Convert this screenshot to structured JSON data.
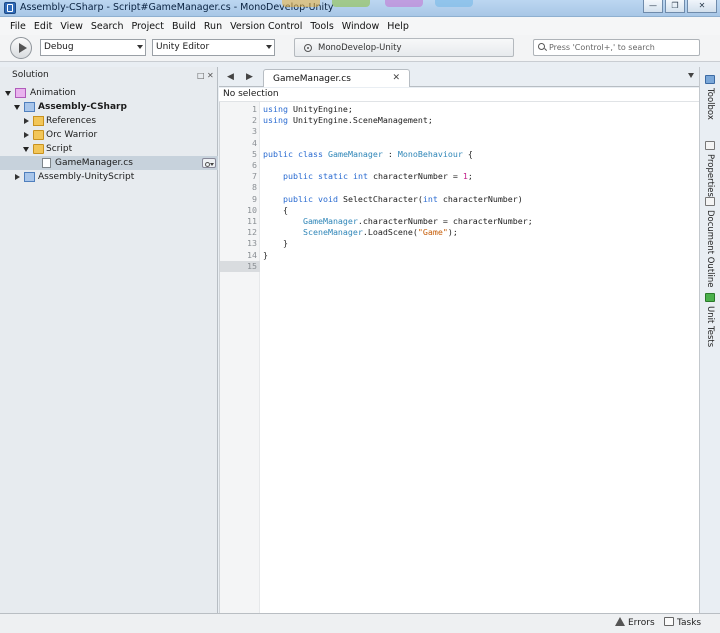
{
  "window": {
    "title": "Assembly-CSharp - Script#GameManager.cs - MonoDevelop-Unity",
    "controls": [
      "—",
      "❐",
      "✕"
    ]
  },
  "menu": [
    "File",
    "Edit",
    "View",
    "Search",
    "Project",
    "Build",
    "Run",
    "Version Control",
    "Tools",
    "Window",
    "Help"
  ],
  "toolbar": {
    "configuration": "Debug",
    "target": "Unity Editor",
    "status": "MonoDevelop-Unity",
    "search_placeholder": "Press 'Control+,' to search"
  },
  "solution": {
    "title": "Solution",
    "tree": [
      {
        "label": "Animation",
        "icon": "solution-icon",
        "expander": "open",
        "bold": false
      },
      {
        "label": "Assembly-CSharp",
        "icon": "project-icon",
        "expander": "open",
        "bold": true
      },
      {
        "label": "References",
        "icon": "references-folder-icon",
        "expander": "closed",
        "bold": false
      },
      {
        "label": "Orc Warrior",
        "icon": "folder-icon",
        "expander": "closed",
        "bold": false
      },
      {
        "label": "Script",
        "icon": "folder-icon",
        "expander": "open",
        "bold": false
      },
      {
        "label": "GameManager.cs",
        "icon": "cs-file-icon",
        "expander": "none",
        "bold": false,
        "selected": true
      },
      {
        "label": "Assembly-UnityScript",
        "icon": "project-icon",
        "expander": "closed",
        "bold": false
      }
    ]
  },
  "editor": {
    "tab": "GameManager.cs",
    "breadcrumb": "No selection",
    "current_line": 15,
    "lines": [
      {
        "n": "1",
        "tokens": [
          [
            "kw",
            "using"
          ],
          [
            "id",
            " UnityEngine;"
          ]
        ]
      },
      {
        "n": "2",
        "tokens": [
          [
            "kw",
            "using"
          ],
          [
            "id",
            " UnityEngine.SceneManagement;"
          ]
        ]
      },
      {
        "n": "3",
        "tokens": []
      },
      {
        "n": "4",
        "tokens": []
      },
      {
        "n": "5",
        "tokens": [
          [
            "kw",
            "public"
          ],
          [
            "id",
            " "
          ],
          [
            "kw",
            "class"
          ],
          [
            "id",
            " "
          ],
          [
            "cls",
            "GameManager"
          ],
          [
            "id",
            " : "
          ],
          [
            "cls",
            "MonoBehaviour"
          ],
          [
            "id",
            " {"
          ]
        ]
      },
      {
        "n": "6",
        "tokens": []
      },
      {
        "n": "7",
        "tokens": [
          [
            "id",
            "    "
          ],
          [
            "kw",
            "public"
          ],
          [
            "id",
            " "
          ],
          [
            "kw",
            "static"
          ],
          [
            "id",
            " "
          ],
          [
            "kw",
            "int"
          ],
          [
            "id",
            " characterNumber = "
          ],
          [
            "num",
            "1"
          ],
          [
            "id",
            ";"
          ]
        ]
      },
      {
        "n": "8",
        "tokens": []
      },
      {
        "n": "9",
        "tokens": [
          [
            "id",
            "    "
          ],
          [
            "kw",
            "public"
          ],
          [
            "id",
            " "
          ],
          [
            "kw",
            "void"
          ],
          [
            "id",
            " SelectCharacter("
          ],
          [
            "kw",
            "int"
          ],
          [
            "id",
            " characterNumber)"
          ]
        ]
      },
      {
        "n": "10",
        "tokens": [
          [
            "id",
            "    {"
          ]
        ]
      },
      {
        "n": "11",
        "tokens": [
          [
            "id",
            "        "
          ],
          [
            "cls",
            "GameManager"
          ],
          [
            "id",
            ".characterNumber = characterNumber;"
          ]
        ]
      },
      {
        "n": "12",
        "tokens": [
          [
            "id",
            "        "
          ],
          [
            "cls",
            "SceneManager"
          ],
          [
            "id",
            ".LoadScene("
          ],
          [
            "str",
            "\"Game\""
          ],
          [
            "id",
            ");"
          ]
        ]
      },
      {
        "n": "13",
        "tokens": [
          [
            "id",
            "    }"
          ]
        ]
      },
      {
        "n": "14",
        "tokens": [
          [
            "id",
            "}"
          ]
        ]
      },
      {
        "n": "15",
        "tokens": []
      }
    ]
  },
  "right_dock": [
    {
      "label": "Toolbox",
      "icon": "toolbox-icon"
    },
    {
      "label": "Properties",
      "icon": "properties-icon"
    },
    {
      "label": "Document Outline",
      "icon": "document-outline-icon"
    },
    {
      "label": "Unit Tests",
      "icon": "unit-tests-icon"
    }
  ],
  "statusbar": {
    "errors": "Errors",
    "tasks": "Tasks"
  },
  "colors": {
    "keyword": "#2a6bd1",
    "type": "#2f86b8",
    "number": "#c3218a",
    "string": "#c65e0a"
  }
}
